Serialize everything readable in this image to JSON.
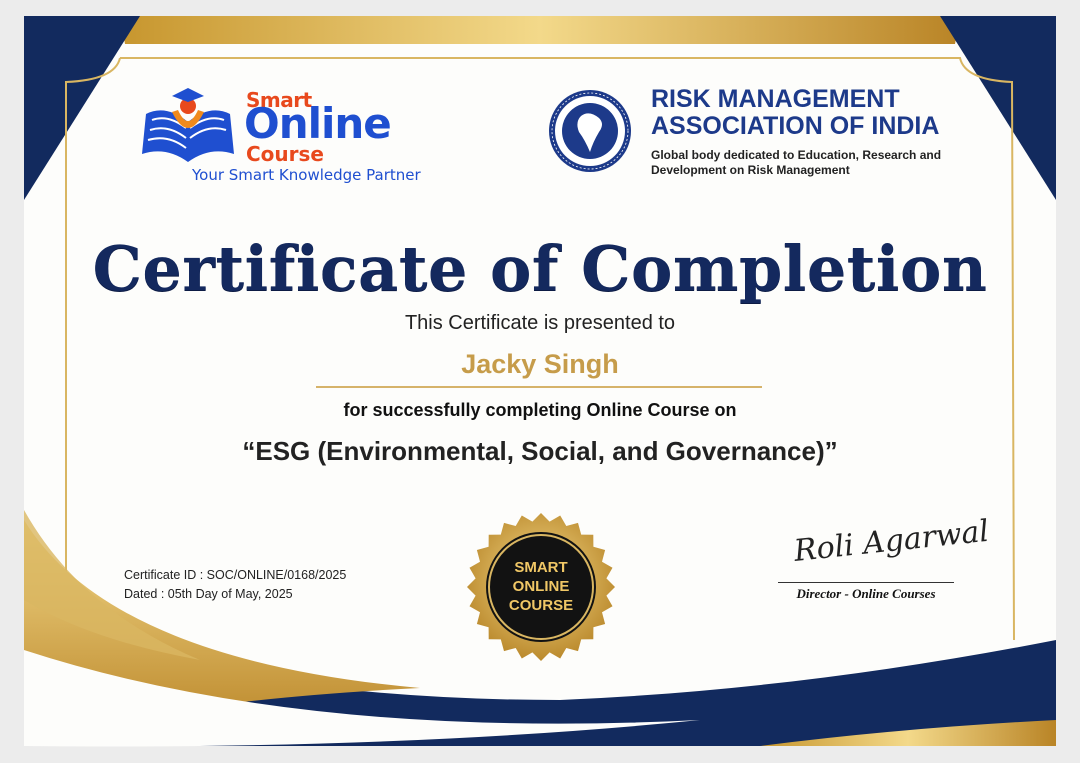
{
  "certificate": {
    "title": "Certificate of Completion",
    "presented_text": "This Certificate is presented to",
    "recipient_name": "Jacky Singh",
    "completion_text": "for successfully completing Online Course on",
    "course_name": "“ESG (Environmental, Social, and Governance)”",
    "certificate_id": "Certificate ID : SOC/ONLINE/0168/2025",
    "dated": "Dated : 05th Day of May, 2025"
  },
  "issuer_logo": {
    "word_smart": "Smart",
    "word_online": "Online",
    "word_course": "Course",
    "tagline": "Your Smart Knowledge Partner"
  },
  "partner": {
    "name": "RISK MANAGEMENT\nASSOCIATION OF INDIA",
    "description": "Global body dedicated to Education, Research and\nDevelopment on Risk Management",
    "seal_text": "RISK MANAGEMENT ASSOCIATION OF INDIA"
  },
  "badge": {
    "lines": [
      "SMART",
      "ONLINE",
      "COURSE"
    ]
  },
  "signature": {
    "signature_text": "Roli Agarwal",
    "role": "Director - Online Courses"
  },
  "colors": {
    "navy": "#14295e",
    "gold": "#c69c4a",
    "blue": "#1f4fd0",
    "orange": "#e8491d"
  }
}
